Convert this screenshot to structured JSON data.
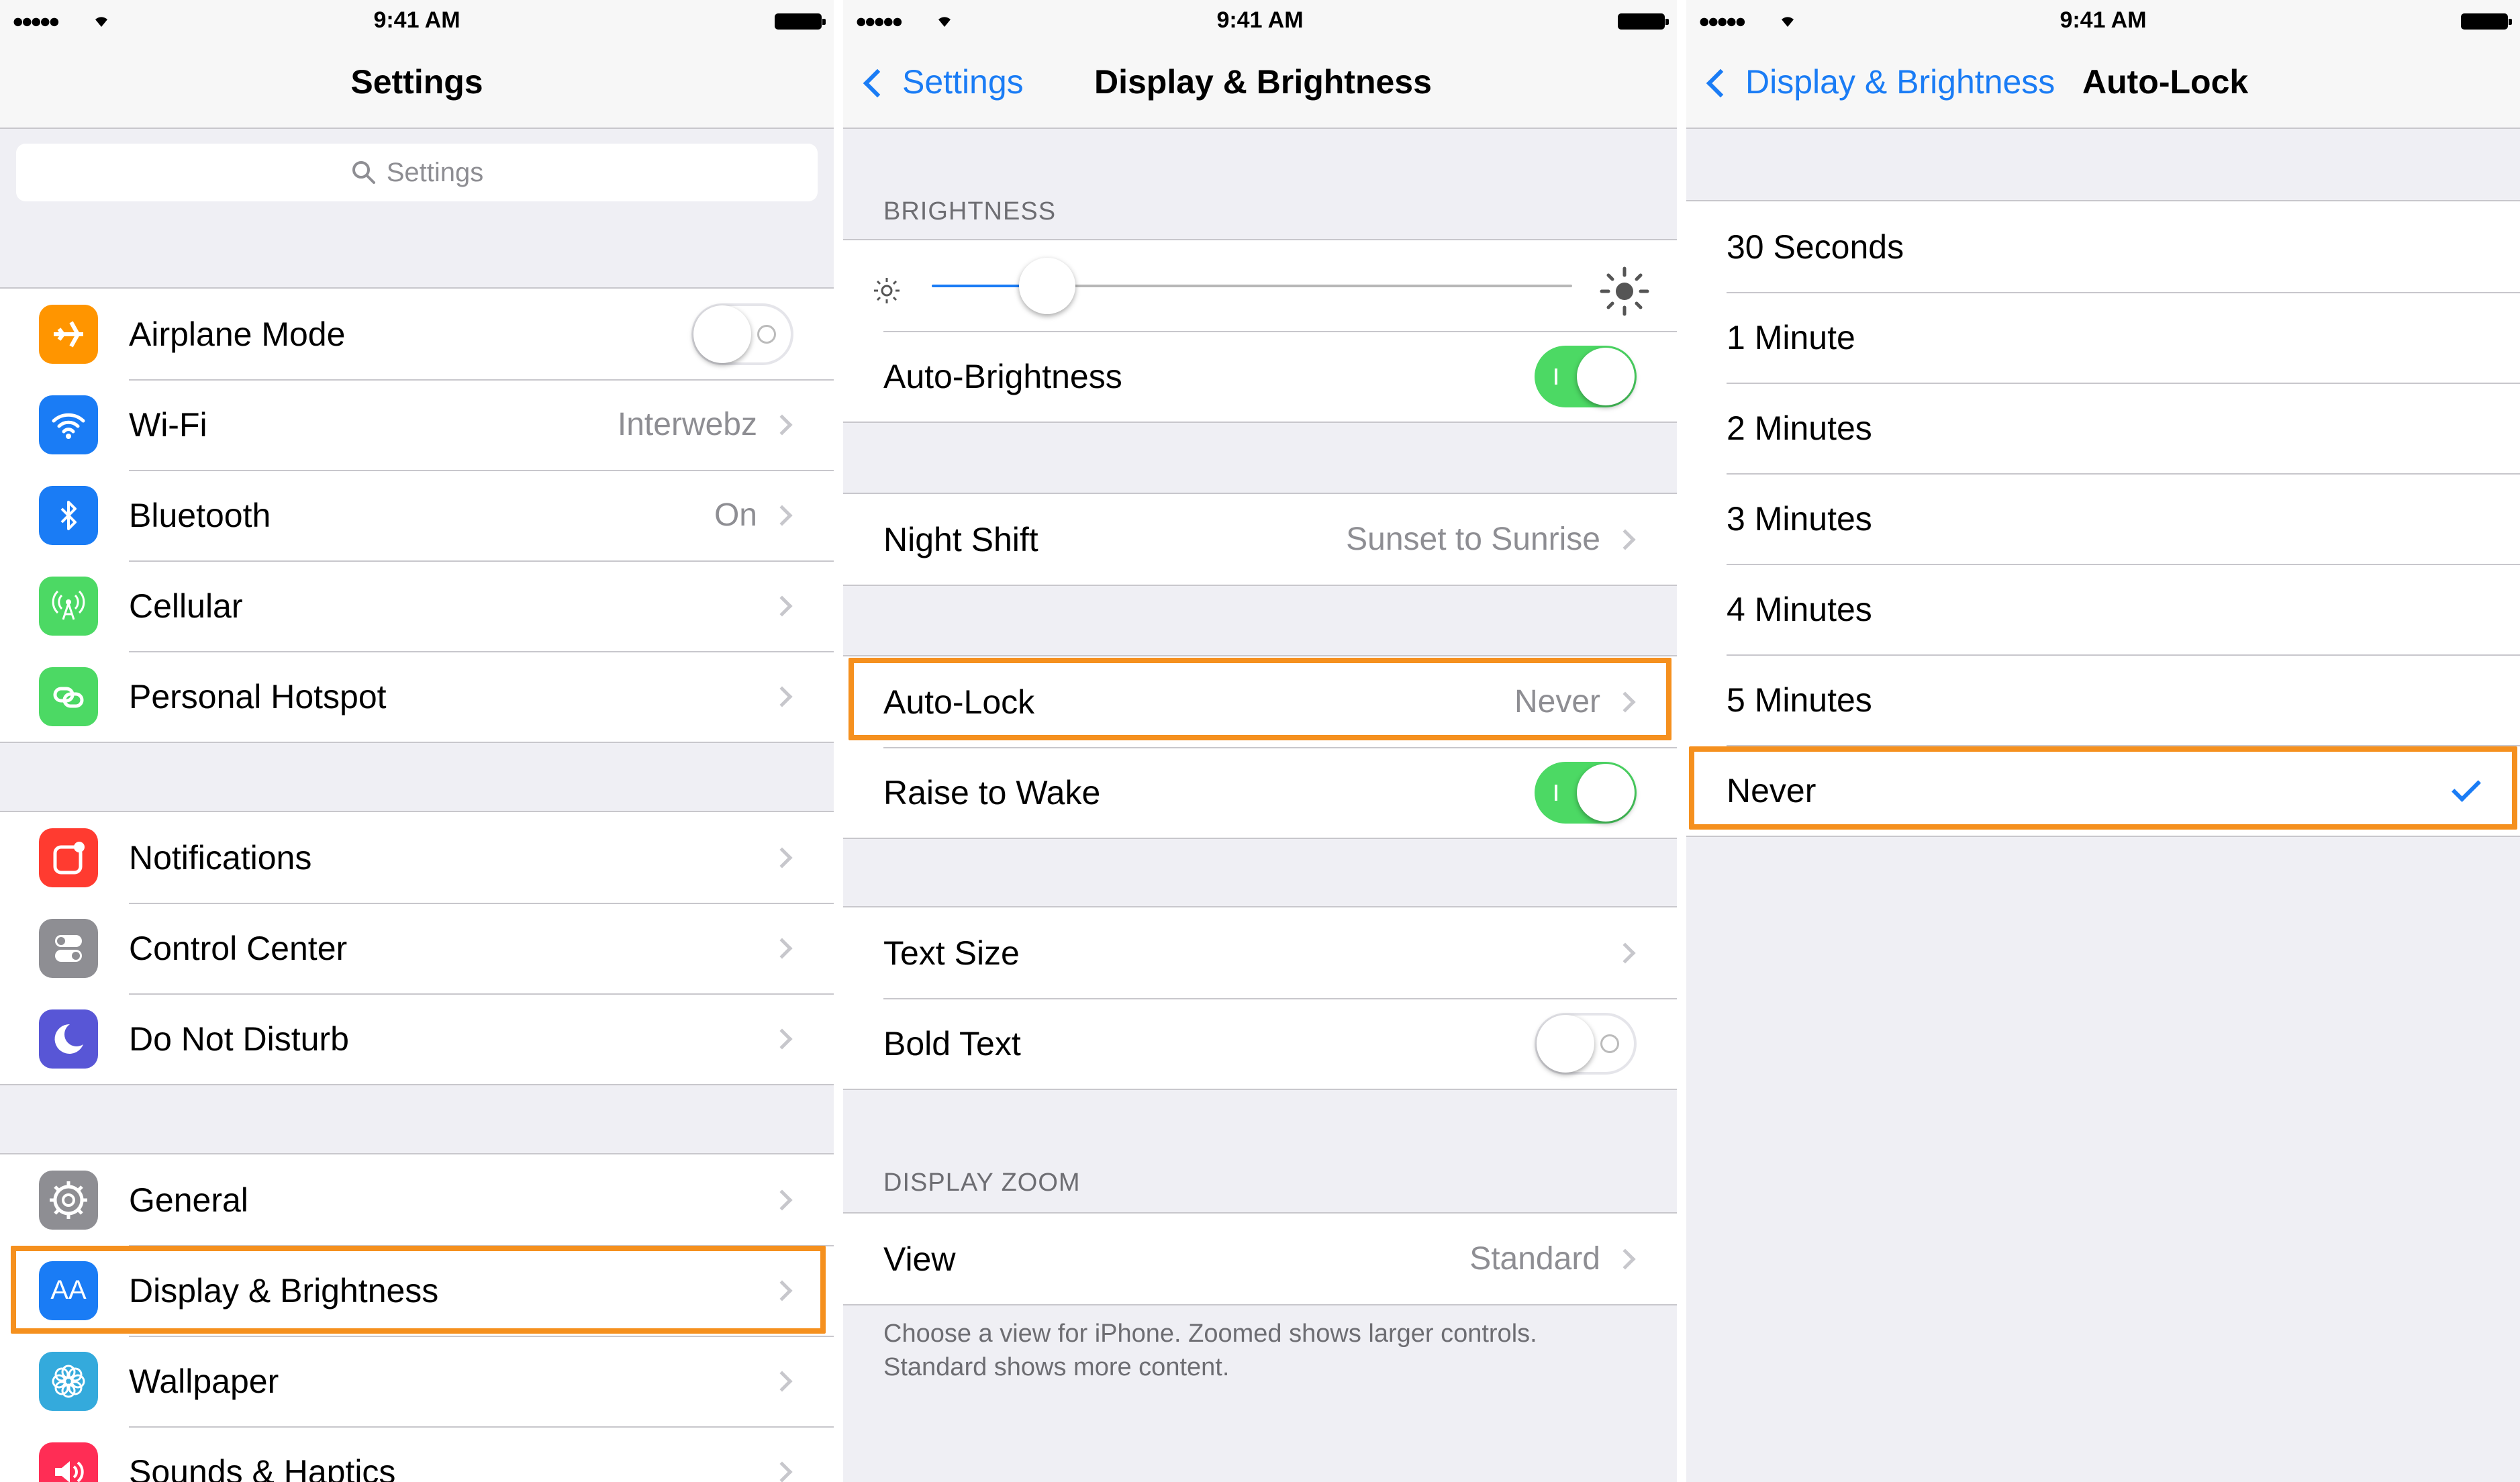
{
  "status": {
    "signal": "●●●●●",
    "time": "9:41 AM"
  },
  "settings": {
    "title": "Settings",
    "search_placeholder": "Settings",
    "group1": [
      {
        "label": "Airplane Mode",
        "icon": "airplane-icon",
        "color": "#ff9500",
        "control": "toggle-off"
      },
      {
        "label": "Wi-Fi",
        "icon": "wifi-icon",
        "color": "#1a7cf5",
        "value": "Interwebz"
      },
      {
        "label": "Bluetooth",
        "icon": "bluetooth-icon",
        "color": "#1a7cf5",
        "value": "On"
      },
      {
        "label": "Cellular",
        "icon": "cellular-icon",
        "color": "#4cd964"
      },
      {
        "label": "Personal Hotspot",
        "icon": "hotspot-icon",
        "color": "#4cd964"
      }
    ],
    "group2": [
      {
        "label": "Notifications",
        "icon": "notifications-icon",
        "color": "#ff3b30"
      },
      {
        "label": "Control Center",
        "icon": "control-center-icon",
        "color": "#8e8e93"
      },
      {
        "label": "Do Not Disturb",
        "icon": "moon-icon",
        "color": "#5856d6"
      }
    ],
    "group3": [
      {
        "label": "General",
        "icon": "gear-icon",
        "color": "#8e8e93"
      },
      {
        "label": "Display & Brightness",
        "icon": "display-icon",
        "color": "#1a7cf5",
        "icon_text": "AA"
      },
      {
        "label": "Wallpaper",
        "icon": "wallpaper-icon",
        "color": "#34aadc"
      },
      {
        "label": "Sounds & Haptics",
        "icon": "speaker-icon",
        "color": "#ff2d55"
      }
    ]
  },
  "display": {
    "back": "Settings",
    "title": "Display & Brightness",
    "brightness_header": "BRIGHTNESS",
    "brightness_level": 0.18,
    "auto_brightness": "Auto-Brightness",
    "night_shift": "Night Shift",
    "night_shift_value": "Sunset to Sunrise",
    "auto_lock": "Auto-Lock",
    "auto_lock_value": "Never",
    "raise_to_wake": "Raise to Wake",
    "text_size": "Text Size",
    "bold_text": "Bold Text",
    "zoom_header": "DISPLAY ZOOM",
    "view": "View",
    "view_value": "Standard",
    "footer": "Choose a view for iPhone. Zoomed shows larger controls. Standard shows more content."
  },
  "autolock": {
    "back": "Display & Brightness",
    "title": "Auto-Lock",
    "options": [
      "30 Seconds",
      "1 Minute",
      "2 Minutes",
      "3 Minutes",
      "4 Minutes",
      "5 Minutes",
      "Never"
    ],
    "selected": "Never"
  },
  "highlight_color": "#f5901e",
  "accent": "#1a7cf5"
}
